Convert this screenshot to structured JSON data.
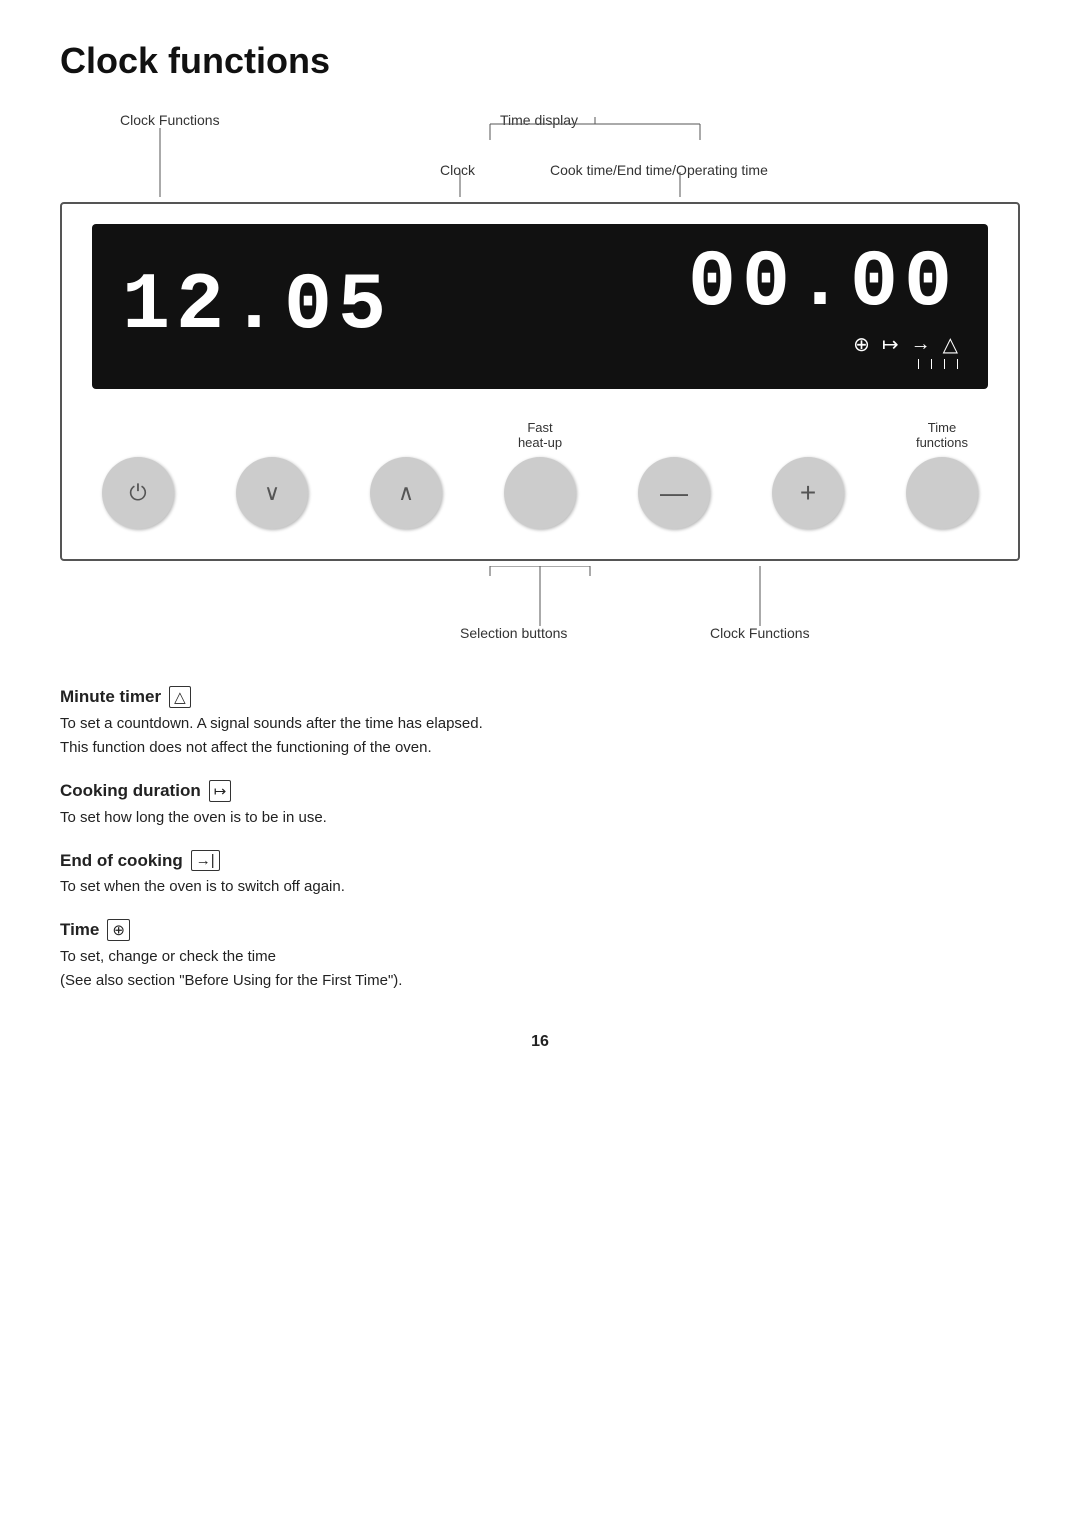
{
  "page": {
    "title": "Clock functions",
    "page_number": "16"
  },
  "diagram": {
    "label_clock_functions": "Clock Functions",
    "label_time_display": "Time display",
    "label_clock": "Clock",
    "label_cook_time": "Cook time/End time/Operating time",
    "display": {
      "time_main": "12.05",
      "time_secondary": "00.00"
    },
    "buttons": [
      {
        "label": "",
        "symbol": "⏻",
        "name": "power-button"
      },
      {
        "label": "",
        "symbol": "∨",
        "name": "down-button"
      },
      {
        "label": "",
        "symbol": "∧",
        "name": "up-button"
      },
      {
        "label": "Fast\nheat-up",
        "symbol": "",
        "name": "fast-heatup-button"
      },
      {
        "label": "",
        "symbol": "—",
        "name": "minus-button"
      },
      {
        "label": "",
        "symbol": "+",
        "name": "plus-button"
      },
      {
        "label": "Time\nfunctions",
        "symbol": "",
        "name": "time-functions-button"
      }
    ],
    "label_selection_buttons": "Selection buttons",
    "label_clock_functions_bottom": "Clock Functions"
  },
  "sections": [
    {
      "id": "minute-timer",
      "title": "Minute timer",
      "icon": "△",
      "text": "To set a countdown. A signal sounds after the time has elapsed.\nThis function does not affect the functioning of the oven."
    },
    {
      "id": "cooking-duration",
      "title": "Cooking duration",
      "icon": "↦",
      "text": "To set how long the oven is to be in use."
    },
    {
      "id": "end-of-cooking",
      "title": "End of cooking",
      "icon": "→|",
      "text": "To set when the oven is to switch off again."
    },
    {
      "id": "time",
      "title": "Time",
      "icon": "⊕",
      "text": "To set, change or check the time\n(See also section \"Before Using for the First Time\")."
    }
  ]
}
